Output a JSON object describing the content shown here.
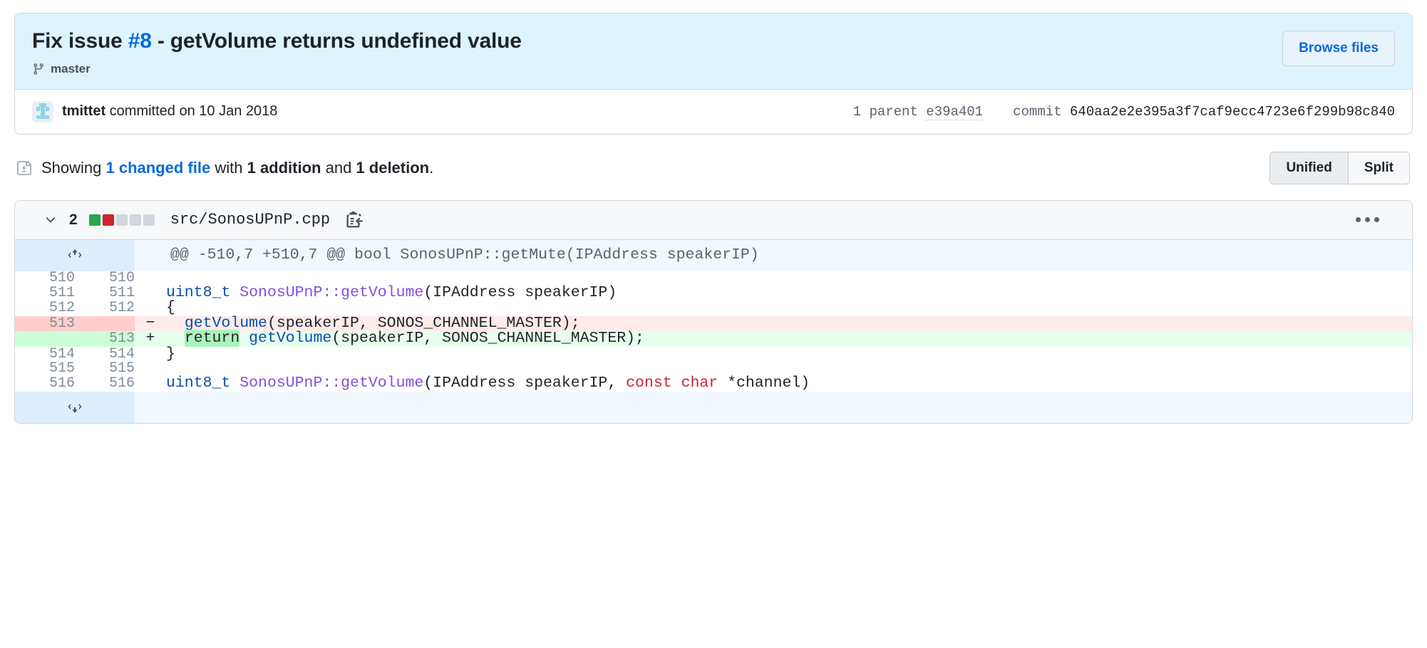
{
  "commit": {
    "title_prefix": "Fix issue ",
    "issue_ref": "#8",
    "title_suffix": " - getVolume returns undefined value",
    "branch": "master",
    "branch_icon": "git-branch-icon",
    "browse_files_label": "Browse files",
    "author": "tmittet",
    "committed_text": " committed on 10 Jan 2018",
    "parent_label": "1 parent ",
    "parent_hash": "e39a401",
    "commit_label": "commit ",
    "commit_sha": "640aa2e2e395a3f7caf9ecc4723e6f299b98c840"
  },
  "showing": {
    "icon": "file-diff-icon",
    "prefix": "Showing ",
    "changed_file_link": "1 changed file",
    "mid": " with ",
    "additions": "1 addition",
    "and": " and ",
    "deletions": "1 deletion",
    "period": ".",
    "view_unified": "Unified",
    "view_split": "Split",
    "active_view": "Unified"
  },
  "file": {
    "collapse_icon": "chevron-down-icon",
    "change_count": "2",
    "diffstat": [
      "#2da44e",
      "#cf222e",
      "#d0d7de",
      "#d0d7de",
      "#d0d7de"
    ],
    "path": "src/SonosUPnP.cpp",
    "copy_icon": "copy-path-icon",
    "menu_icon": "kebab-menu-icon"
  },
  "diff": {
    "hunk_header": "@@ -510,7 +510,7 @@ bool SonosUPnP::getMute(IPAddress speakerIP)",
    "expand_up_icon": "expand-up-icon",
    "expand_down_icon": "expand-down-icon",
    "rows": [
      {
        "type": "hunk",
        "old": "",
        "new": "",
        "marker": "",
        "icon": "expand-up-icon"
      },
      {
        "type": "ctx",
        "old": "510",
        "new": "510",
        "marker": "",
        "code": ""
      },
      {
        "type": "ctx",
        "old": "511",
        "new": "511",
        "marker": "",
        "code": "uint8_t SonosUPnP::getVolume(IPAddress speakerIP)"
      },
      {
        "type": "ctx",
        "old": "512",
        "new": "512",
        "marker": "",
        "code": "{"
      },
      {
        "type": "del",
        "old": "513",
        "new": "",
        "marker": "−",
        "code": "  getVolume(speakerIP, SONOS_CHANNEL_MASTER);"
      },
      {
        "type": "add",
        "old": "",
        "new": "513",
        "marker": "+",
        "code": "  return getVolume(speakerIP, SONOS_CHANNEL_MASTER);"
      },
      {
        "type": "ctx",
        "old": "514",
        "new": "514",
        "marker": "",
        "code": "}"
      },
      {
        "type": "ctx",
        "old": "515",
        "new": "515",
        "marker": "",
        "code": ""
      },
      {
        "type": "ctx",
        "old": "516",
        "new": "516",
        "marker": "",
        "code": "uint8_t SonosUPnP::getVolume(IPAddress speakerIP, const char *channel)"
      },
      {
        "type": "hunk",
        "old": "",
        "new": "",
        "marker": "",
        "icon": "expand-down-icon"
      }
    ]
  },
  "colors": {
    "accent_blue": "#0969da",
    "header_bg": "#ddf4ff",
    "addition_bg": "#e6ffec",
    "deletion_bg": "#ffebe9",
    "word_add_bg": "#abf2bc",
    "type_blue": "#0550ae",
    "fn_purple": "#8250df",
    "kw_red": "#cf222e"
  }
}
